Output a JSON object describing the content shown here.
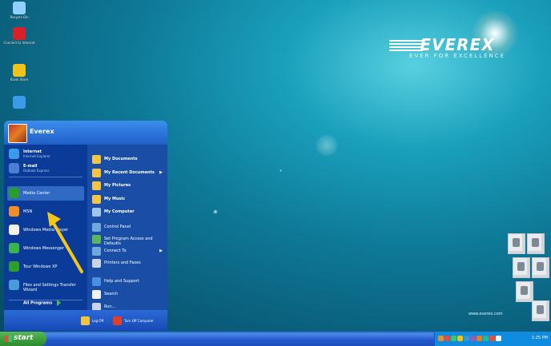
{
  "desktop": {
    "icons": [
      {
        "label": "Recycle Bin",
        "icon": "recycle-bin-icon",
        "color": "#8fd0ff"
      },
      {
        "label": "Connect to Internet",
        "icon": "internet-connect-icon",
        "color": "#d8202a"
      },
      {
        "label": "Kiosk Store",
        "icon": "kiosk-icon",
        "color": "#f0c419"
      },
      {
        "label": "",
        "icon": "ie-icon",
        "color": "#3b9be8"
      }
    ],
    "brand_name": "EVEREX",
    "brand_tagline": "EVER FOR EXCELLENCE",
    "url": "www.everex.com"
  },
  "start_menu": {
    "user_name": "Everex",
    "pinned": [
      {
        "label": "Internet",
        "sub": "Internet Explorer",
        "icon": "ie-icon",
        "color": "#3b9be8"
      },
      {
        "label": "E-mail",
        "sub": "Outlook Express",
        "icon": "mail-icon",
        "color": "#4a7fd1"
      }
    ],
    "recent": [
      {
        "label": "Media Center",
        "icon": "media-center-icon",
        "color": "#2c9c2c",
        "highlight": true
      },
      {
        "label": "MSN",
        "icon": "msn-butterfly-icon",
        "color": "#f28c28",
        "highlight": false
      },
      {
        "label": "Windows Media Player",
        "icon": "media-player-icon",
        "color": "#f2f2f2",
        "highlight": false
      },
      {
        "label": "Windows Messenger",
        "icon": "messenger-icon",
        "color": "#3ab54a",
        "highlight": false
      },
      {
        "label": "Tour Windows XP",
        "icon": "tour-icon",
        "color": "#2ca02c",
        "highlight": false
      },
      {
        "label": "Files and Settings Transfer Wizard",
        "icon": "transfer-wizard-icon",
        "color": "#4a9cd9",
        "highlight": false
      }
    ],
    "all_programs": "All Programs",
    "places": [
      {
        "label": "My Documents",
        "icon": "folder-icon",
        "color": "#f5c542",
        "bold": true,
        "sub": ""
      },
      {
        "label": "My Recent Documents",
        "icon": "recent-docs-icon",
        "color": "#f5c542",
        "bold": true,
        "sub": "▶"
      },
      {
        "label": "My Pictures",
        "icon": "pictures-folder-icon",
        "color": "#f5c542",
        "bold": true,
        "sub": ""
      },
      {
        "label": "My Music",
        "icon": "music-folder-icon",
        "color": "#f5c542",
        "bold": true,
        "sub": ""
      },
      {
        "label": "My Computer",
        "icon": "computer-icon",
        "color": "#9fc6ee",
        "bold": true,
        "sub": ""
      }
    ],
    "system": [
      {
        "label": "Control Panel",
        "icon": "control-panel-icon",
        "color": "#6fa8dc",
        "sub": ""
      },
      {
        "label": "Set Program Access and Defaults",
        "icon": "program-access-icon",
        "color": "#58b858",
        "sub": ""
      },
      {
        "label": "Connect To",
        "icon": "connect-icon",
        "color": "#6fa8dc",
        "sub": "▶"
      },
      {
        "label": "Printers and Faxes",
        "icon": "printer-icon",
        "color": "#c9d4e4",
        "sub": ""
      }
    ],
    "tools": [
      {
        "label": "Help and Support",
        "icon": "help-icon",
        "color": "#4a90e2"
      },
      {
        "label": "Search",
        "icon": "search-icon",
        "color": "#f2f2f2"
      },
      {
        "label": "Run...",
        "icon": "run-icon",
        "color": "#c9d4e4"
      }
    ],
    "log_off": "Log Off",
    "turn_off": "Turn Off Computer"
  },
  "taskbar": {
    "start_label": "start",
    "clock": "1:25 PM",
    "tray_colors": [
      "#f28c28",
      "#e74c3c",
      "#2ecc71",
      "#f1c40f",
      "#3498db",
      "#9b59b6",
      "#e67e22",
      "#1abc9c",
      "#e74c3c",
      "#ffffff"
    ]
  },
  "annotation": {
    "arrow_color": "#f5c518"
  }
}
